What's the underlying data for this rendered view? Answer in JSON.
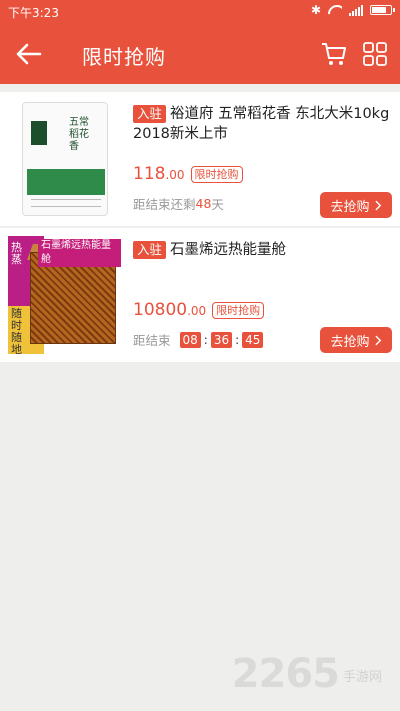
{
  "status": {
    "time": "下午3:23"
  },
  "header": {
    "title": "限时抢购",
    "back_icon": "back-arrow-icon",
    "cart_icon": "cart-icon",
    "grid_icon": "grid-icon"
  },
  "colors": {
    "accent": "#e8523c"
  },
  "products": [
    {
      "tag": "入驻",
      "name": "裕道府 五常稻花香 东北大米10kg 2018新米上市",
      "price_int": "118",
      "price_dec": ".00",
      "flash_label": "限时抢购",
      "remaining_prefix": "距结束还剩",
      "remaining_days": "48",
      "remaining_unit": "天",
      "buy_label": "去抢购",
      "thumb_chars": "五常稻花香"
    },
    {
      "tag": "入驻",
      "name": "石墨烯远热能量舱",
      "price_int": "10800",
      "price_dec": ".00",
      "flash_label": "限时抢购",
      "countdown_label": "距结束",
      "hours": "08",
      "minutes": "36",
      "seconds": "45",
      "buy_label": "去抢购",
      "thumb_banner": "石墨烯远热能量舱",
      "thumb_side_top": "热蒸",
      "thumb_side_bottom": "随时随地"
    }
  ],
  "watermark": {
    "number": "2265",
    "site": "手游网"
  }
}
